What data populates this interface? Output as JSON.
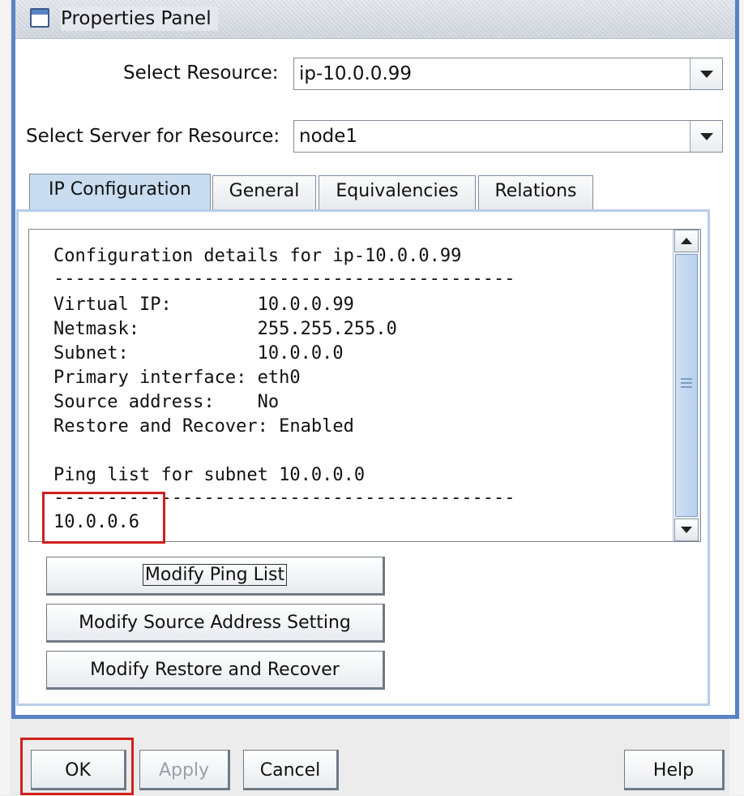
{
  "window": {
    "title": "Properties Panel"
  },
  "form": {
    "resource_label": "Select Resource:",
    "resource_value": "ip-10.0.0.99",
    "server_label": "Select Server for Resource:",
    "server_value": "node1"
  },
  "tabs": [
    "IP Configuration",
    "General",
    "Equivalencies",
    "Relations"
  ],
  "details": {
    "lines": [
      "Configuration details for ip-10.0.0.99",
      "-------------------------------------------",
      "Virtual IP:        10.0.0.99",
      "Netmask:           255.255.255.0",
      "Subnet:            10.0.0.0",
      "Primary interface: eth0",
      "Source address:    No",
      "Restore and Recover: Enabled",
      "",
      "Ping list for subnet 10.0.0.0",
      "-------------------------------------------",
      "10.0.0.6"
    ]
  },
  "actions": {
    "modify_ping": "Modify Ping List",
    "modify_source": "Modify Source Address Setting",
    "modify_restore": "Modify Restore and Recover"
  },
  "footer": {
    "ok": "OK",
    "apply": "Apply",
    "cancel": "Cancel",
    "help": "Help"
  },
  "colors": {
    "highlight": "#d0201c",
    "accent": "#5a82c5"
  }
}
